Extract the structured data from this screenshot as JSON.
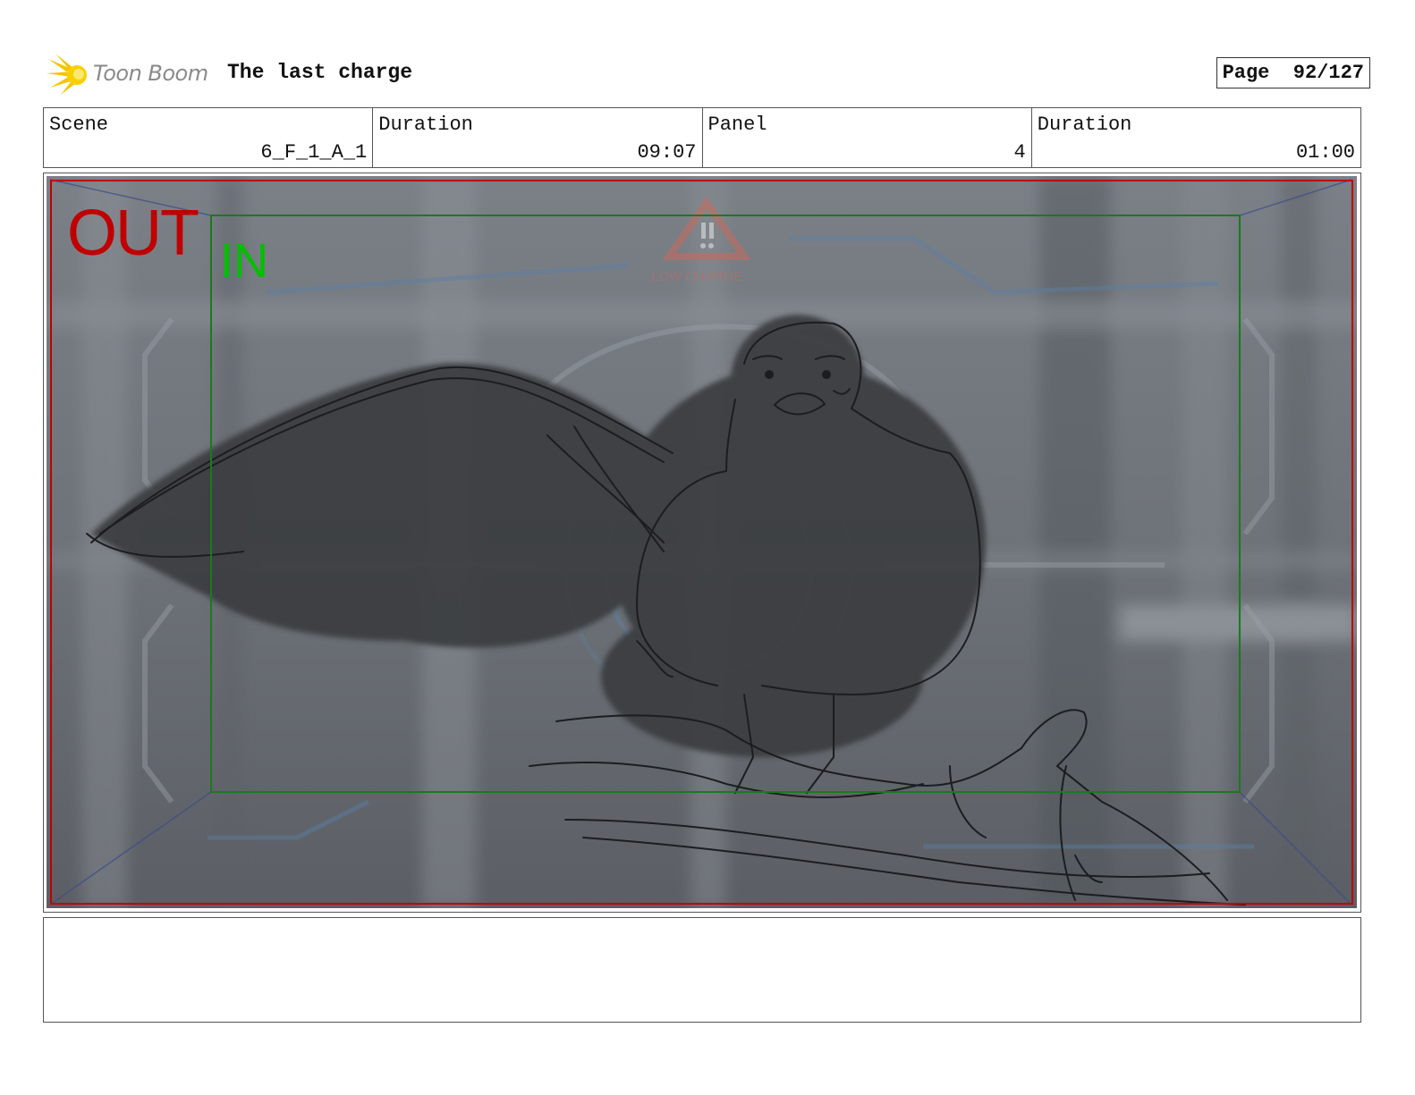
{
  "header": {
    "brand": "Toon Boom",
    "title": "The last charge",
    "page_label": "Page",
    "page_value": "92/127"
  },
  "info": {
    "scene_label": "Scene",
    "scene_value": "6_F_1_A_1",
    "scene_duration_label": "Duration",
    "scene_duration_value": "09:07",
    "panel_label": "Panel",
    "panel_value": "4",
    "panel_duration_label": "Duration",
    "panel_duration_value": "01:00"
  },
  "panel": {
    "out_label": "OUT",
    "in_label": "IN",
    "hud_warning": "LOW CHARGE"
  },
  "colors": {
    "out_frame": "#c00000",
    "in_frame": "#1a7a1a",
    "brand_spark": "#f5c400"
  }
}
